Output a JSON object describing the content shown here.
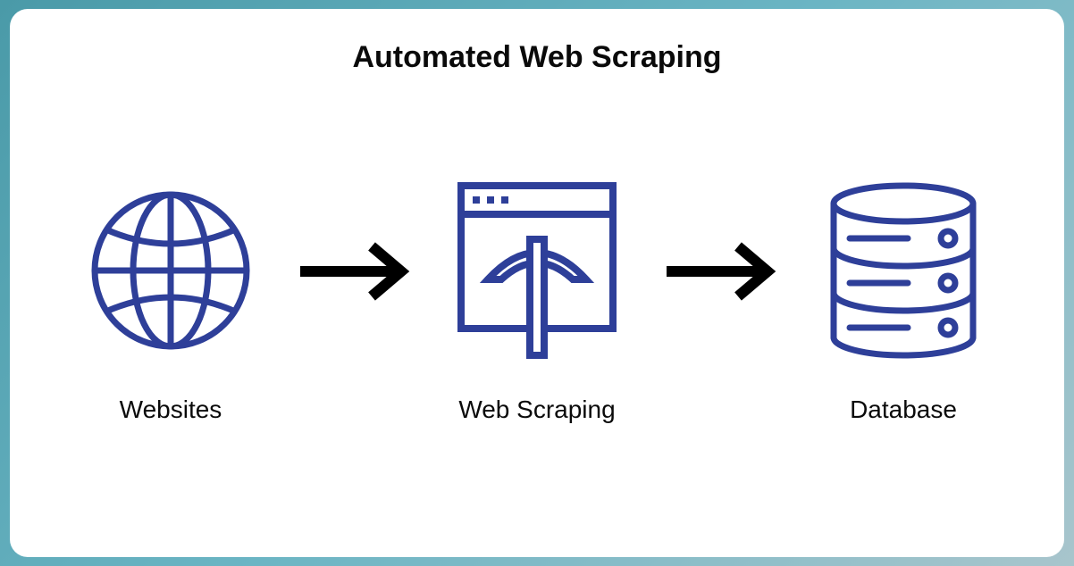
{
  "title": "Automated Web Scraping",
  "steps": {
    "websites": {
      "label": "Websites",
      "icon": "globe-icon"
    },
    "scraping": {
      "label": "Web Scraping",
      "icon": "scraper-icon"
    },
    "database": {
      "label": "Database",
      "icon": "database-icon"
    }
  },
  "colors": {
    "accent": "#2e3f99",
    "arrow": "#000000",
    "text": "#0a0a0a"
  }
}
